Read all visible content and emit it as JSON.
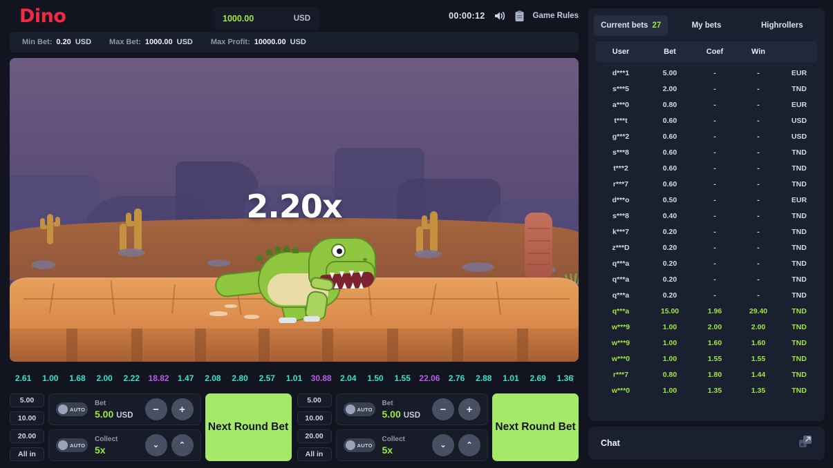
{
  "header": {
    "logo": "Dino",
    "balance_amount": "1000.00",
    "balance_currency": "USD",
    "timer": "00:00:12",
    "sound_icon": "sound-on-icon",
    "rules_icon": "clipboard-icon",
    "rules_label": "Game Rules"
  },
  "limits": [
    {
      "key": "Min Bet:",
      "value": "0.20",
      "currency": "USD"
    },
    {
      "key": "Max Bet:",
      "value": "1000.00",
      "currency": "USD"
    },
    {
      "key": "Max Profit:",
      "value": "10000.00",
      "currency": "USD"
    }
  ],
  "stage": {
    "multiplier": "2.20x",
    "character": "dinosaur-trex"
  },
  "history": {
    "items": [
      {
        "value": "2.61",
        "high": false
      },
      {
        "value": "1.00",
        "high": false
      },
      {
        "value": "1.68",
        "high": false
      },
      {
        "value": "2.00",
        "high": false
      },
      {
        "value": "2.22",
        "high": false
      },
      {
        "value": "18.82",
        "high": true
      },
      {
        "value": "1.47",
        "high": false
      },
      {
        "value": "2.08",
        "high": false
      },
      {
        "value": "2.80",
        "high": false
      },
      {
        "value": "2.57",
        "high": false
      },
      {
        "value": "1.01",
        "high": false
      },
      {
        "value": "30.88",
        "high": true
      },
      {
        "value": "2.04",
        "high": false
      },
      {
        "value": "1.50",
        "high": false
      },
      {
        "value": "1.55",
        "high": false
      },
      {
        "value": "22.06",
        "high": true
      },
      {
        "value": "2.76",
        "high": false
      },
      {
        "value": "2.88",
        "high": false
      },
      {
        "value": "1.01",
        "high": false
      },
      {
        "value": "2.69",
        "high": false
      },
      {
        "value": "1.36",
        "high": false
      }
    ],
    "expand_icon": "arrow-up-icon"
  },
  "bet_panels": [
    {
      "quick_amounts": [
        "5.00",
        "10.00",
        "20.00",
        "All in"
      ],
      "auto_label": "AUTO",
      "bet_label": "Bet",
      "bet_value": "5.00",
      "bet_currency": "USD",
      "collect_label": "Collect",
      "collect_value": "5x",
      "minus": "−",
      "plus": "+",
      "down": "⌄",
      "up": "⌃",
      "action_label": "Next Round Bet"
    },
    {
      "quick_amounts": [
        "5.00",
        "10.00",
        "20.00",
        "All in"
      ],
      "auto_label": "AUTO",
      "bet_label": "Bet",
      "bet_value": "5.00",
      "bet_currency": "USD",
      "collect_label": "Collect",
      "collect_value": "5x",
      "minus": "−",
      "plus": "+",
      "down": "⌄",
      "up": "⌃",
      "action_label": "Next Round Bet"
    }
  ],
  "sidebar": {
    "tabs": [
      {
        "label": "Current bets",
        "count": "27",
        "active": true
      },
      {
        "label": "My bets",
        "count": "",
        "active": false
      },
      {
        "label": "Highrollers",
        "count": "",
        "active": false
      }
    ],
    "columns": [
      "User",
      "Bet",
      "Coef",
      "Win",
      ""
    ],
    "rows": [
      {
        "user": "d***1",
        "bet": "5.00",
        "coef": "-",
        "win": "-",
        "currency": "EUR",
        "won": false
      },
      {
        "user": "s***5",
        "bet": "2.00",
        "coef": "-",
        "win": "-",
        "currency": "TND",
        "won": false
      },
      {
        "user": "a***0",
        "bet": "0.80",
        "coef": "-",
        "win": "-",
        "currency": "EUR",
        "won": false
      },
      {
        "user": "t***t",
        "bet": "0.60",
        "coef": "-",
        "win": "-",
        "currency": "USD",
        "won": false
      },
      {
        "user": "g***2",
        "bet": "0.60",
        "coef": "-",
        "win": "-",
        "currency": "USD",
        "won": false
      },
      {
        "user": "s***8",
        "bet": "0.60",
        "coef": "-",
        "win": "-",
        "currency": "TND",
        "won": false
      },
      {
        "user": "t***2",
        "bet": "0.60",
        "coef": "-",
        "win": "-",
        "currency": "TND",
        "won": false
      },
      {
        "user": "r***7",
        "bet": "0.60",
        "coef": "-",
        "win": "-",
        "currency": "TND",
        "won": false
      },
      {
        "user": "d***o",
        "bet": "0.50",
        "coef": "-",
        "win": "-",
        "currency": "EUR",
        "won": false
      },
      {
        "user": "s***8",
        "bet": "0.40",
        "coef": "-",
        "win": "-",
        "currency": "TND",
        "won": false
      },
      {
        "user": "k***7",
        "bet": "0.20",
        "coef": "-",
        "win": "-",
        "currency": "TND",
        "won": false
      },
      {
        "user": "z***D",
        "bet": "0.20",
        "coef": "-",
        "win": "-",
        "currency": "TND",
        "won": false
      },
      {
        "user": "q***a",
        "bet": "0.20",
        "coef": "-",
        "win": "-",
        "currency": "TND",
        "won": false
      },
      {
        "user": "q***a",
        "bet": "0.20",
        "coef": "-",
        "win": "-",
        "currency": "TND",
        "won": false
      },
      {
        "user": "q***a",
        "bet": "0.20",
        "coef": "-",
        "win": "-",
        "currency": "TND",
        "won": false
      },
      {
        "user": "q***a",
        "bet": "15.00",
        "coef": "1.96",
        "win": "29.40",
        "currency": "TND",
        "won": true
      },
      {
        "user": "w***9",
        "bet": "1.00",
        "coef": "2.00",
        "win": "2.00",
        "currency": "TND",
        "won": true
      },
      {
        "user": "w***9",
        "bet": "1.00",
        "coef": "1.60",
        "win": "1.60",
        "currency": "TND",
        "won": true
      },
      {
        "user": "w***0",
        "bet": "1.00",
        "coef": "1.55",
        "win": "1.55",
        "currency": "TND",
        "won": true
      },
      {
        "user": "r***7",
        "bet": "0.80",
        "coef": "1.80",
        "win": "1.44",
        "currency": "TND",
        "won": true
      },
      {
        "user": "w***0",
        "bet": "1.00",
        "coef": "1.35",
        "win": "1.35",
        "currency": "TND",
        "won": true
      }
    ]
  },
  "chat": {
    "title": "Chat",
    "expand_icon": "popout-icon"
  },
  "colors": {
    "accent_green": "#9ee840",
    "button_green": "#a5e86a",
    "logo_red": "#ef2b44",
    "history_normal": "#3fe0c8",
    "history_high": "#b85ce8",
    "panel_bg": "#1b2030",
    "page_bg": "#12151f"
  }
}
